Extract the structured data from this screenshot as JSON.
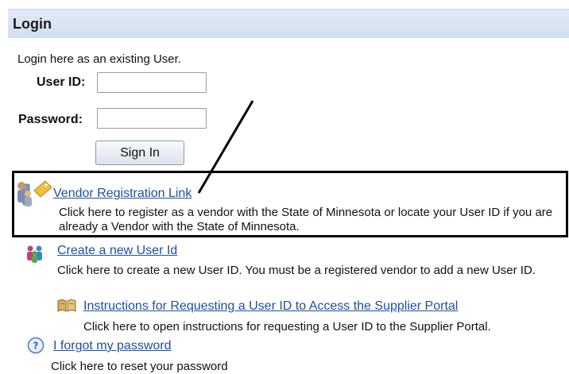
{
  "panel": {
    "title": "Login"
  },
  "intro": "Login here as an existing User.",
  "form": {
    "user_id_label": "User ID:",
    "user_id_value": "",
    "password_label": "Password:",
    "password_value": "",
    "sign_in_label": "Sign In"
  },
  "links": [
    {
      "label": "Vendor Registration Link",
      "icon": "vendor-registration-icon",
      "description": "Click here to register as a vendor with the State of Minnesota or locate your User ID if you are already a Vendor with the State of Minnesota."
    },
    {
      "label": "Create a new User Id",
      "icon": "users-icon",
      "description": "Click here to create a new User ID. You must be a registered vendor to add a new User ID."
    },
    {
      "label": "Instructions for Requesting a User ID to Access the Supplier Portal",
      "icon": "book-icon",
      "description": "Click here to open instructions for requesting a User ID to the Supplier Portal."
    },
    {
      "label": "I forgot my password",
      "icon": "help-icon",
      "description": "Click here to reset your password"
    }
  ],
  "colors": {
    "link": "#1d4f9e",
    "header_bg": "#d9e3f2",
    "highlight_box": "#000000"
  }
}
